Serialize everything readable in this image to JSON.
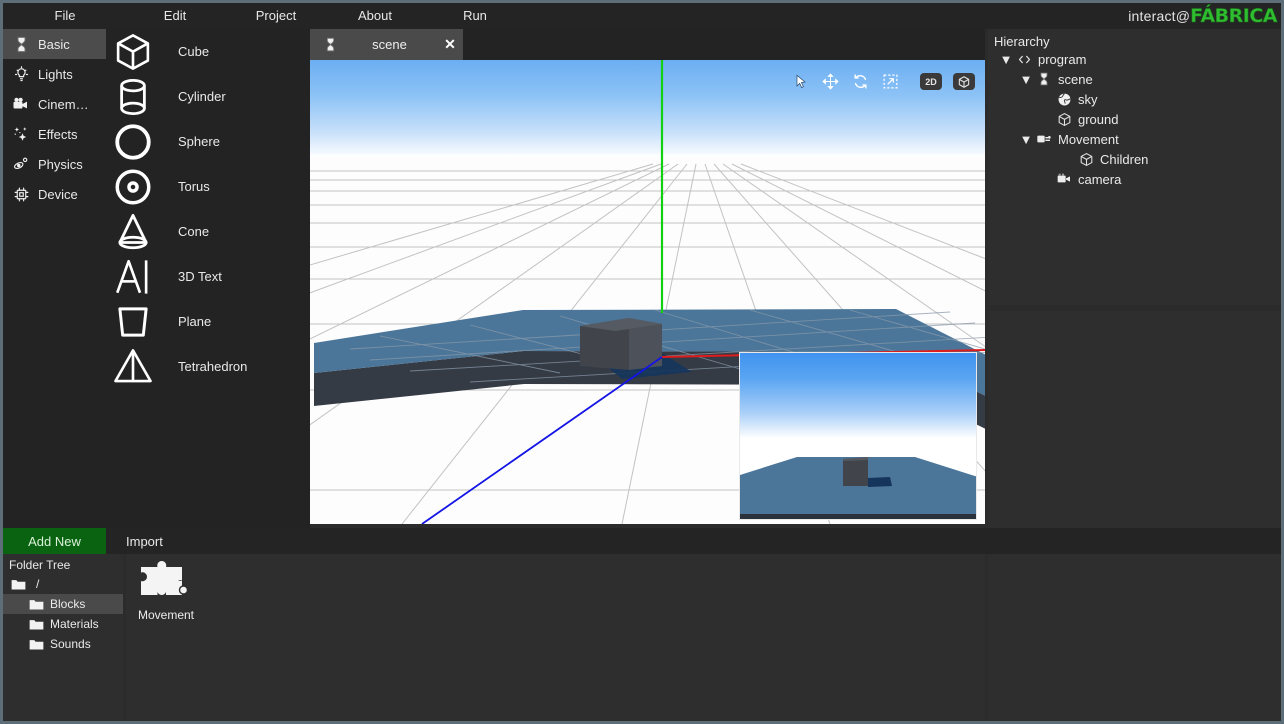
{
  "app": {
    "brand_prefix": "interact@",
    "brand_name": "FÁBRICA",
    "brand_color": "#2fbe2f"
  },
  "menubar": {
    "items": [
      {
        "label": "File",
        "icon": "menu-file"
      },
      {
        "label": "Edit",
        "icon": "menu-edit"
      },
      {
        "label": "Project",
        "icon": "menu-project"
      },
      {
        "label": "About",
        "icon": "menu-about"
      },
      {
        "label": "Run",
        "icon": "menu-run"
      }
    ]
  },
  "categories": {
    "selected": "Basic",
    "items": [
      {
        "label": "Basic",
        "icon": "hourglass-icon"
      },
      {
        "label": "Lights",
        "icon": "lightbulb-icon"
      },
      {
        "label": "Cinem…",
        "icon": "video-camera-icon"
      },
      {
        "label": "Effects",
        "icon": "sparkles-icon"
      },
      {
        "label": "Physics",
        "icon": "physics-icon"
      },
      {
        "label": "Device",
        "icon": "chip-icon"
      }
    ]
  },
  "shapes": {
    "items": [
      {
        "label": "Cube",
        "icon": "cube-icon"
      },
      {
        "label": "Cylinder",
        "icon": "cylinder-icon"
      },
      {
        "label": "Sphere",
        "icon": "sphere-icon"
      },
      {
        "label": "Torus",
        "icon": "torus-icon"
      },
      {
        "label": "Cone",
        "icon": "cone-icon"
      },
      {
        "label": "3D Text",
        "icon": "text3d-icon"
      },
      {
        "label": "Plane",
        "icon": "plane-icon"
      },
      {
        "label": "Tetrahedron",
        "icon": "tetrahedron-icon"
      }
    ]
  },
  "tabs": {
    "active": "scene",
    "items": [
      {
        "label": "scene",
        "icon": "scene-icon",
        "close": "✕"
      }
    ]
  },
  "viewport": {
    "tools": [
      {
        "name": "select-tool",
        "icon": "cursor-arrow-icon"
      },
      {
        "name": "move-tool",
        "icon": "move-arrows-icon"
      },
      {
        "name": "rotate-tool",
        "icon": "rotate-arrows-icon"
      },
      {
        "name": "scale-tool",
        "icon": "scale-corner-icon"
      }
    ],
    "view_badges": [
      {
        "label": "2D",
        "icon": "view-2d-badge"
      },
      {
        "label": "",
        "icon": "view-3d-badge"
      }
    ],
    "axes": {
      "x_color": "#e01b1b",
      "y_color": "#12d112",
      "z_color": "#1414e6"
    },
    "sky_top_color": "#6caef2",
    "platform_color": "#4b7699",
    "cube_color": "#4a4e54"
  },
  "hierarchy": {
    "title": "Hierarchy",
    "nodes": [
      {
        "label": "program",
        "icon": "code-icon",
        "arrow": "▼",
        "depth": 0
      },
      {
        "label": "scene",
        "icon": "scene-icon",
        "arrow": "▼",
        "depth": 1
      },
      {
        "label": "sky",
        "icon": "sky-globe-icon",
        "arrow": "",
        "depth": 2
      },
      {
        "label": "ground",
        "icon": "cube-icon",
        "arrow": "",
        "depth": 2
      },
      {
        "label": "Movement",
        "icon": "block-icon",
        "arrow": "▼",
        "depth": 2
      },
      {
        "label": "Children",
        "icon": "cube-icon",
        "arrow": "",
        "depth": 3
      },
      {
        "label": "camera",
        "icon": "camera-icon",
        "arrow": "",
        "depth": 2
      }
    ]
  },
  "assetbar": {
    "add_new_label": "Add New",
    "import_label": "Import"
  },
  "folder_tree": {
    "title": "Folder Tree",
    "selected": "Blocks",
    "items": [
      {
        "label": "/",
        "icon": "folder-icon",
        "depth": 0
      },
      {
        "label": "Blocks",
        "icon": "folder-icon",
        "depth": 1
      },
      {
        "label": "Materials",
        "icon": "folder-icon",
        "depth": 1
      },
      {
        "label": "Sounds",
        "icon": "folder-icon",
        "depth": 1
      }
    ]
  },
  "assets": {
    "items": [
      {
        "label": "Movement",
        "icon": "puzzle-piece-icon"
      }
    ]
  }
}
